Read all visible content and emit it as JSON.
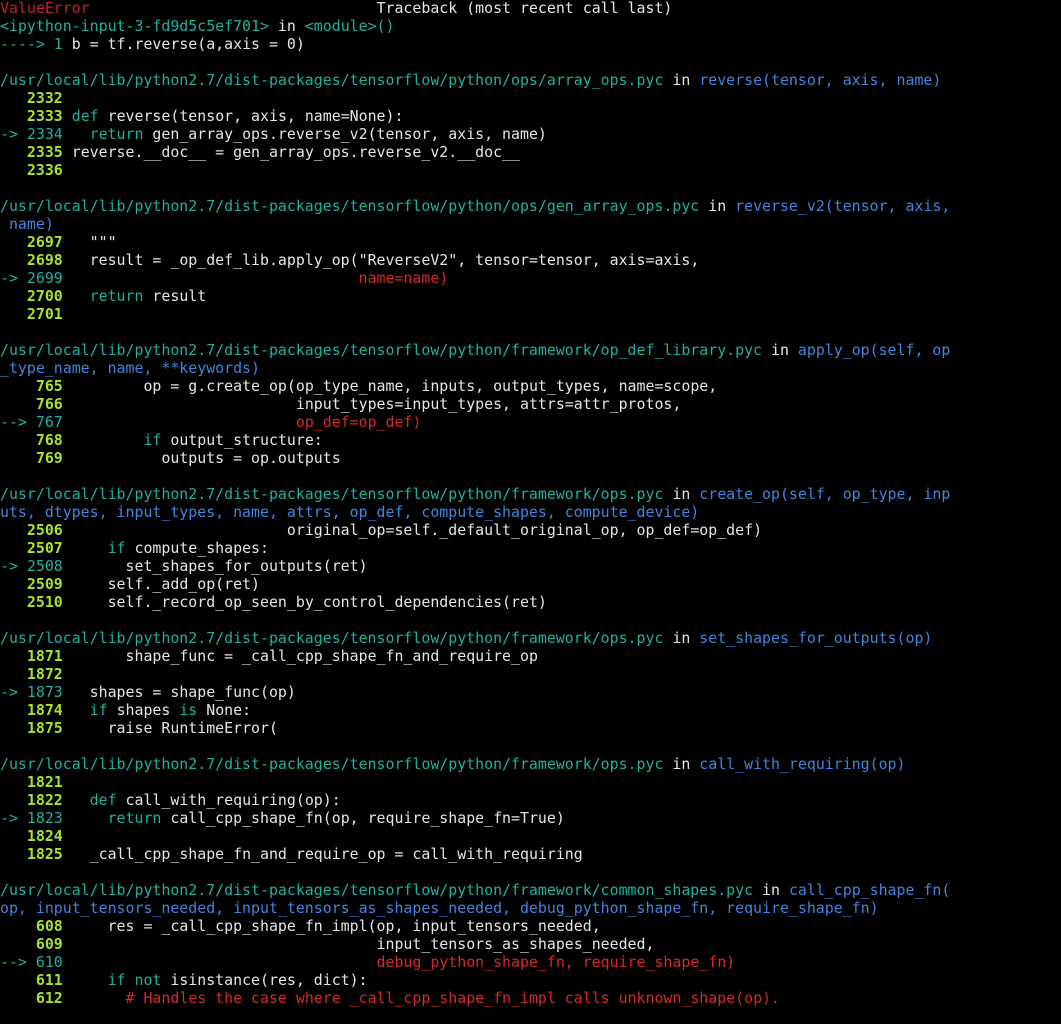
{
  "terminal": {
    "lines": [
      {
        "segments": [
          {
            "t": "ValueError",
            "c": "err"
          },
          {
            "t": "                                Traceback (most recent call last)",
            "c": "tb"
          }
        ]
      },
      {
        "segments": [
          {
            "t": "<ipython-input-3-fd9d5c5ef701>",
            "c": "mod"
          },
          {
            "t": " in ",
            "c": "tb"
          },
          {
            "t": "<module>()",
            "c": "mod"
          }
        ]
      },
      {
        "segments": [
          {
            "t": "----> 1 ",
            "c": "curnum"
          },
          {
            "t": "b = tf.reverse(a,axis = 0)",
            "c": "code"
          }
        ]
      },
      {
        "segments": []
      },
      {
        "segments": [
          {
            "t": "/usr/local/lib/python2.7/dist-packages/tensorflow/python/ops/array_ops.pyc",
            "c": "path"
          },
          {
            "t": " in ",
            "c": "tb"
          },
          {
            "t": "reverse(tensor, axis, name)",
            "c": "fn"
          }
        ]
      },
      {
        "segments": [
          {
            "t": "   2332",
            "c": "num"
          }
        ]
      },
      {
        "segments": [
          {
            "t": "   2333 ",
            "c": "num"
          },
          {
            "t": "def ",
            "c": "kw"
          },
          {
            "t": "reverse(tensor, axis, name=None):",
            "c": "code"
          }
        ]
      },
      {
        "segments": [
          {
            "t": "-> 2334 ",
            "c": "curnum"
          },
          {
            "t": "  return ",
            "c": "kw"
          },
          {
            "t": "gen_array_ops.reverse_v2(tensor, axis, name)",
            "c": "code"
          }
        ]
      },
      {
        "segments": [
          {
            "t": "   2335 ",
            "c": "num"
          },
          {
            "t": "reverse.__doc__ = gen_array_ops.reverse_v2.__doc__",
            "c": "code"
          }
        ]
      },
      {
        "segments": [
          {
            "t": "   2336",
            "c": "num"
          }
        ]
      },
      {
        "segments": []
      },
      {
        "segments": [
          {
            "t": "/usr/local/lib/python2.7/dist-packages/tensorflow/python/ops/gen_array_ops.pyc",
            "c": "path"
          },
          {
            "t": " in ",
            "c": "tb"
          },
          {
            "t": "reverse_v2(tensor, axis,",
            "c": "fn"
          }
        ]
      },
      {
        "segments": [
          {
            "t": " name)",
            "c": "fn"
          }
        ]
      },
      {
        "segments": [
          {
            "t": "   2697 ",
            "c": "num"
          },
          {
            "t": "  \"\"\"",
            "c": "code"
          }
        ]
      },
      {
        "segments": [
          {
            "t": "   2698 ",
            "c": "num"
          },
          {
            "t": "  result = _op_def_lib.apply_op(\"ReverseV2\", tensor=tensor, axis=axis,",
            "c": "code"
          }
        ]
      },
      {
        "segments": [
          {
            "t": "-> 2699 ",
            "c": "curnum"
          },
          {
            "t": "                                name=name)",
            "c": "hl"
          }
        ]
      },
      {
        "segments": [
          {
            "t": "   2700 ",
            "c": "num"
          },
          {
            "t": "  return ",
            "c": "kw"
          },
          {
            "t": "result",
            "c": "code"
          }
        ]
      },
      {
        "segments": [
          {
            "t": "   2701",
            "c": "num"
          }
        ]
      },
      {
        "segments": []
      },
      {
        "segments": [
          {
            "t": "/usr/local/lib/python2.7/dist-packages/tensorflow/python/framework/op_def_library.pyc",
            "c": "path"
          },
          {
            "t": " in ",
            "c": "tb"
          },
          {
            "t": "apply_op(self, op",
            "c": "fn"
          }
        ]
      },
      {
        "segments": [
          {
            "t": "_type_name, name, **keywords)",
            "c": "fn"
          }
        ]
      },
      {
        "segments": [
          {
            "t": "    765 ",
            "c": "num"
          },
          {
            "t": "        op = g.create_op(op_type_name, inputs, output_types, name=scope,",
            "c": "code"
          }
        ]
      },
      {
        "segments": [
          {
            "t": "    766 ",
            "c": "num"
          },
          {
            "t": "                         input_types=input_types, attrs=attr_protos,",
            "c": "code"
          }
        ]
      },
      {
        "segments": [
          {
            "t": "--> 767 ",
            "c": "curnum"
          },
          {
            "t": "                         op_def=op_def)",
            "c": "hl"
          }
        ]
      },
      {
        "segments": [
          {
            "t": "    768 ",
            "c": "num"
          },
          {
            "t": "        if ",
            "c": "kw"
          },
          {
            "t": "output_structure:",
            "c": "code"
          }
        ]
      },
      {
        "segments": [
          {
            "t": "    769 ",
            "c": "num"
          },
          {
            "t": "          outputs = op.outputs",
            "c": "code"
          }
        ]
      },
      {
        "segments": []
      },
      {
        "segments": [
          {
            "t": "/usr/local/lib/python2.7/dist-packages/tensorflow/python/framework/ops.pyc",
            "c": "path"
          },
          {
            "t": " in ",
            "c": "tb"
          },
          {
            "t": "create_op(self, op_type, inp",
            "c": "fn"
          }
        ]
      },
      {
        "segments": [
          {
            "t": "uts, dtypes, input_types, name, attrs, op_def, compute_shapes, compute_device)",
            "c": "fn"
          }
        ]
      },
      {
        "segments": [
          {
            "t": "   2506 ",
            "c": "num"
          },
          {
            "t": "                        original_op=self._default_original_op, op_def=op_def)",
            "c": "code"
          }
        ]
      },
      {
        "segments": [
          {
            "t": "   2507 ",
            "c": "num"
          },
          {
            "t": "    if ",
            "c": "kw"
          },
          {
            "t": "compute_shapes:",
            "c": "code"
          }
        ]
      },
      {
        "segments": [
          {
            "t": "-> 2508 ",
            "c": "curnum"
          },
          {
            "t": "      set_shapes_for_outputs(ret)",
            "c": "code"
          }
        ]
      },
      {
        "segments": [
          {
            "t": "   2509 ",
            "c": "num"
          },
          {
            "t": "    self._add_op(ret)",
            "c": "code"
          }
        ]
      },
      {
        "segments": [
          {
            "t": "   2510 ",
            "c": "num"
          },
          {
            "t": "    self._record_op_seen_by_control_dependencies(ret)",
            "c": "code"
          }
        ]
      },
      {
        "segments": []
      },
      {
        "segments": [
          {
            "t": "/usr/local/lib/python2.7/dist-packages/tensorflow/python/framework/ops.pyc",
            "c": "path"
          },
          {
            "t": " in ",
            "c": "tb"
          },
          {
            "t": "set_shapes_for_outputs(op)",
            "c": "fn"
          }
        ]
      },
      {
        "segments": [
          {
            "t": "   1871 ",
            "c": "num"
          },
          {
            "t": "      shape_func = _call_cpp_shape_fn_and_require_op",
            "c": "code"
          }
        ]
      },
      {
        "segments": [
          {
            "t": "   1872",
            "c": "num"
          }
        ]
      },
      {
        "segments": [
          {
            "t": "-> 1873 ",
            "c": "curnum"
          },
          {
            "t": "  shapes = shape_func(op)",
            "c": "code"
          }
        ]
      },
      {
        "segments": [
          {
            "t": "   1874 ",
            "c": "num"
          },
          {
            "t": "  if ",
            "c": "kw"
          },
          {
            "t": "shapes ",
            "c": "code"
          },
          {
            "t": "is ",
            "c": "kw"
          },
          {
            "t": "None:",
            "c": "code"
          }
        ]
      },
      {
        "segments": [
          {
            "t": "   1875 ",
            "c": "num"
          },
          {
            "t": "    raise RuntimeError(",
            "c": "code"
          }
        ]
      },
      {
        "segments": []
      },
      {
        "segments": [
          {
            "t": "/usr/local/lib/python2.7/dist-packages/tensorflow/python/framework/ops.pyc",
            "c": "path"
          },
          {
            "t": " in ",
            "c": "tb"
          },
          {
            "t": "call_with_requiring(op)",
            "c": "fn"
          }
        ]
      },
      {
        "segments": [
          {
            "t": "   1821",
            "c": "num"
          }
        ]
      },
      {
        "segments": [
          {
            "t": "   1822 ",
            "c": "num"
          },
          {
            "t": "  def ",
            "c": "kw"
          },
          {
            "t": "call_with_requiring(op):",
            "c": "code"
          }
        ]
      },
      {
        "segments": [
          {
            "t": "-> 1823 ",
            "c": "curnum"
          },
          {
            "t": "    return ",
            "c": "kw"
          },
          {
            "t": "call_cpp_shape_fn(op, require_shape_fn=True)",
            "c": "code"
          }
        ]
      },
      {
        "segments": [
          {
            "t": "   1824",
            "c": "num"
          }
        ]
      },
      {
        "segments": [
          {
            "t": "   1825 ",
            "c": "num"
          },
          {
            "t": "  _call_cpp_shape_fn_and_require_op = call_with_requiring",
            "c": "code"
          }
        ]
      },
      {
        "segments": []
      },
      {
        "segments": [
          {
            "t": "/usr/local/lib/python2.7/dist-packages/tensorflow/python/framework/common_shapes.pyc",
            "c": "path"
          },
          {
            "t": " in ",
            "c": "tb"
          },
          {
            "t": "call_cpp_shape_fn(",
            "c": "fn"
          }
        ]
      },
      {
        "segments": [
          {
            "t": "op, input_tensors_needed, input_tensors_as_shapes_needed, debug_python_shape_fn, require_shape_fn)",
            "c": "fn"
          }
        ]
      },
      {
        "segments": [
          {
            "t": "    608 ",
            "c": "num"
          },
          {
            "t": "    res = _call_cpp_shape_fn_impl(op, input_tensors_needed,",
            "c": "code"
          }
        ]
      },
      {
        "segments": [
          {
            "t": "    609 ",
            "c": "num"
          },
          {
            "t": "                                  input_tensors_as_shapes_needed,",
            "c": "code"
          }
        ]
      },
      {
        "segments": [
          {
            "t": "--> 610 ",
            "c": "curnum"
          },
          {
            "t": "                                  debug_python_shape_fn, require_shape_fn)",
            "c": "hl"
          }
        ]
      },
      {
        "segments": [
          {
            "t": "    611 ",
            "c": "num"
          },
          {
            "t": "    if not ",
            "c": "kw"
          },
          {
            "t": "isinstance(res, dict):",
            "c": "code"
          }
        ]
      },
      {
        "segments": [
          {
            "t": "    612 ",
            "c": "num"
          },
          {
            "t": "      # Handles the case where _call_cpp_shape_fn_impl calls unknown_shape(op).",
            "c": "cm"
          }
        ]
      }
    ]
  }
}
